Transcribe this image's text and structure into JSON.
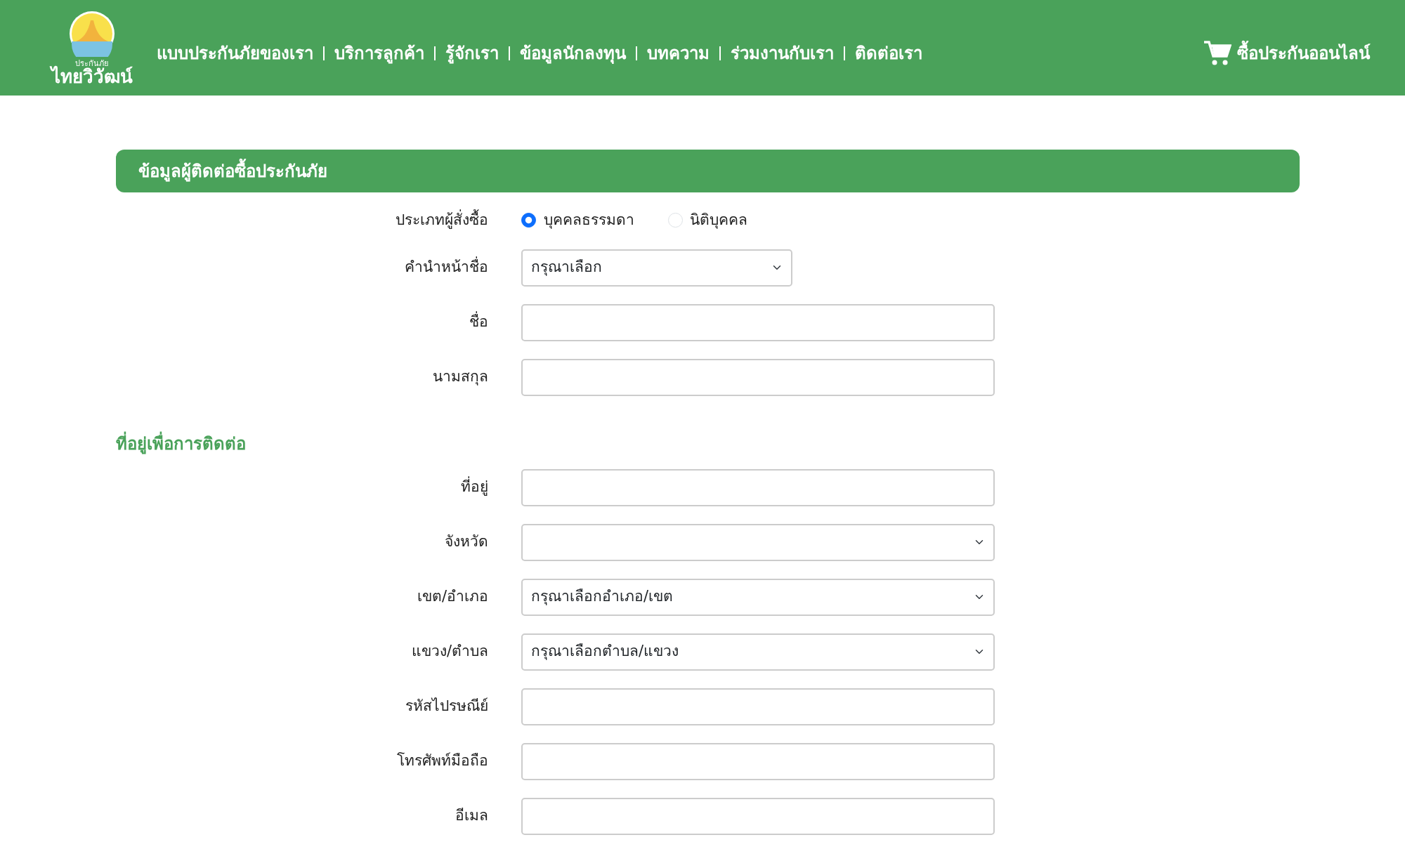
{
  "header": {
    "logo": {
      "caption": "ประกันภัย",
      "name": "ไทยวิวัฒน์"
    },
    "nav": [
      "แบบประกันภัยของเรา",
      "บริการลูกค้า",
      "รู้จักเรา",
      "ข้อมูลนักลงทุน",
      "บทความ",
      "ร่วมงานกับเรา",
      "ติดต่อเรา"
    ],
    "cart_link": "ซื้อประกันออนไลน์"
  },
  "form": {
    "title": "ข้อมูลผู้ติดต่อซื้อประกันภัย",
    "fields": [
      {
        "kind": "radio",
        "label": "ประเภทผู้สั่งซื้อ",
        "options": [
          {
            "label": "บุคคลธรรมดา",
            "selected": true
          },
          {
            "label": "นิติบุคคล",
            "selected": false
          }
        ]
      },
      {
        "kind": "shortselect",
        "label": "คำนำหน้าชื่อ",
        "value": "กรุณาเลือก"
      },
      {
        "kind": "text",
        "label": "ชื่อ"
      },
      {
        "kind": "text",
        "label": "นามสกุล"
      }
    ],
    "address_heading": "ที่อยู่เพื่อการติดต่อ",
    "address_fields": [
      {
        "kind": "text",
        "label": "ที่อยู่"
      },
      {
        "kind": "select",
        "label": "จังหวัด"
      },
      {
        "kind": "select",
        "label": "เขต/อำเภอ",
        "value": "กรุณาเลือกอำเภอ/เขต"
      },
      {
        "kind": "select",
        "label": "แขวง/ตำบล",
        "value": "กรุณาเลือกตำบล/แขวง"
      },
      {
        "kind": "text",
        "label": "รหัสไปรษณีย์"
      },
      {
        "kind": "text",
        "label": "โทรศัพท์มือถือ"
      },
      {
        "kind": "text",
        "label": "อีเมล"
      }
    ]
  }
}
